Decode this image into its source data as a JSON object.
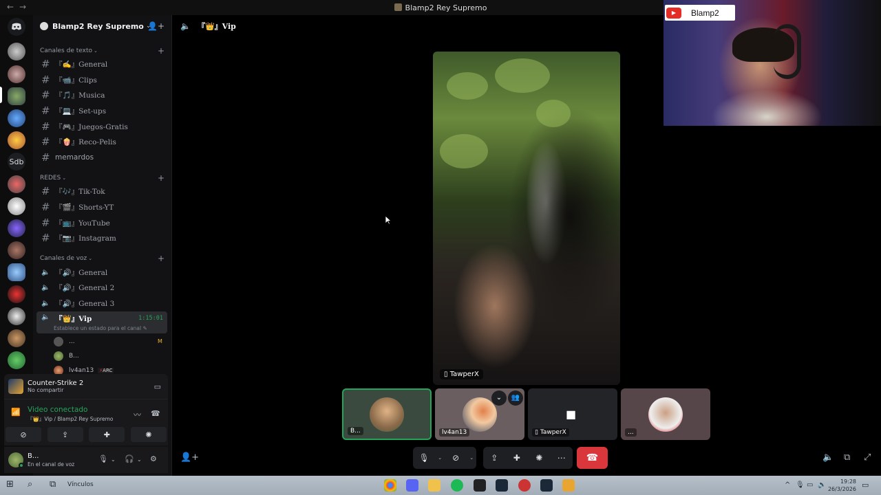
{
  "window": {
    "title": "Blamp2 Rey Supremo"
  },
  "guild": {
    "name": "Blamp2 Rey Supremo"
  },
  "categories": {
    "text": "Canales de texto",
    "redes": "REDES",
    "voice": "Canales de voz"
  },
  "text_channels": [
    {
      "label": "『✍』General"
    },
    {
      "label": "『📹』Clips"
    },
    {
      "label": "『🎵』Musica"
    },
    {
      "label": "『💻』Set-ups"
    },
    {
      "label": "『🎮』Juegos-Gratis"
    },
    {
      "label": "『🍿』Reco-Pelis"
    },
    {
      "label": "memardos"
    }
  ],
  "redes_channels": [
    {
      "label": "『🎶』Tik-Tok"
    },
    {
      "label": "『🎬』Shorts-YT"
    },
    {
      "label": "『📺』YouTube"
    },
    {
      "label": "『📷』Instagram"
    }
  ],
  "voice_channels": [
    {
      "label": "『🔊』General"
    },
    {
      "label": "『🔊』General 2"
    },
    {
      "label": "『🔊』General 3"
    }
  ],
  "active_voice": {
    "label": "『👑』Vip",
    "timer": "1:15:01",
    "status_placeholder": "Establece un estado para el canal"
  },
  "voice_users": [
    {
      "name": "...",
      "badge": ""
    },
    {
      "name": "B...",
      "badge": ""
    },
    {
      "name": "lv4an13",
      "badge": "ARC"
    }
  ],
  "activity": {
    "game": "Counter-Strike 2",
    "sub": "No compartir"
  },
  "voice_panel": {
    "title": "Video conectado",
    "sub": "『👑』Vip / Blamp2 Rey Supremo"
  },
  "user_panel": {
    "name": "B...",
    "status": "En el canal de voz"
  },
  "call": {
    "channel": "『👑』Vip",
    "main_video_user": "TawperX",
    "tiles": [
      {
        "label": "B..."
      },
      {
        "label": "lv4an13"
      },
      {
        "label": "TawperX"
      },
      {
        "label": "..."
      }
    ]
  },
  "overlay": {
    "channel_name": "Blamp2"
  },
  "taskbar": {
    "links_label": "Vínculos",
    "time": "19:28",
    "date": "26/3/2026"
  },
  "colors": {
    "online_green": "#23a55a",
    "hangup_red": "#da373c",
    "youtube_red": "#e52d27"
  }
}
